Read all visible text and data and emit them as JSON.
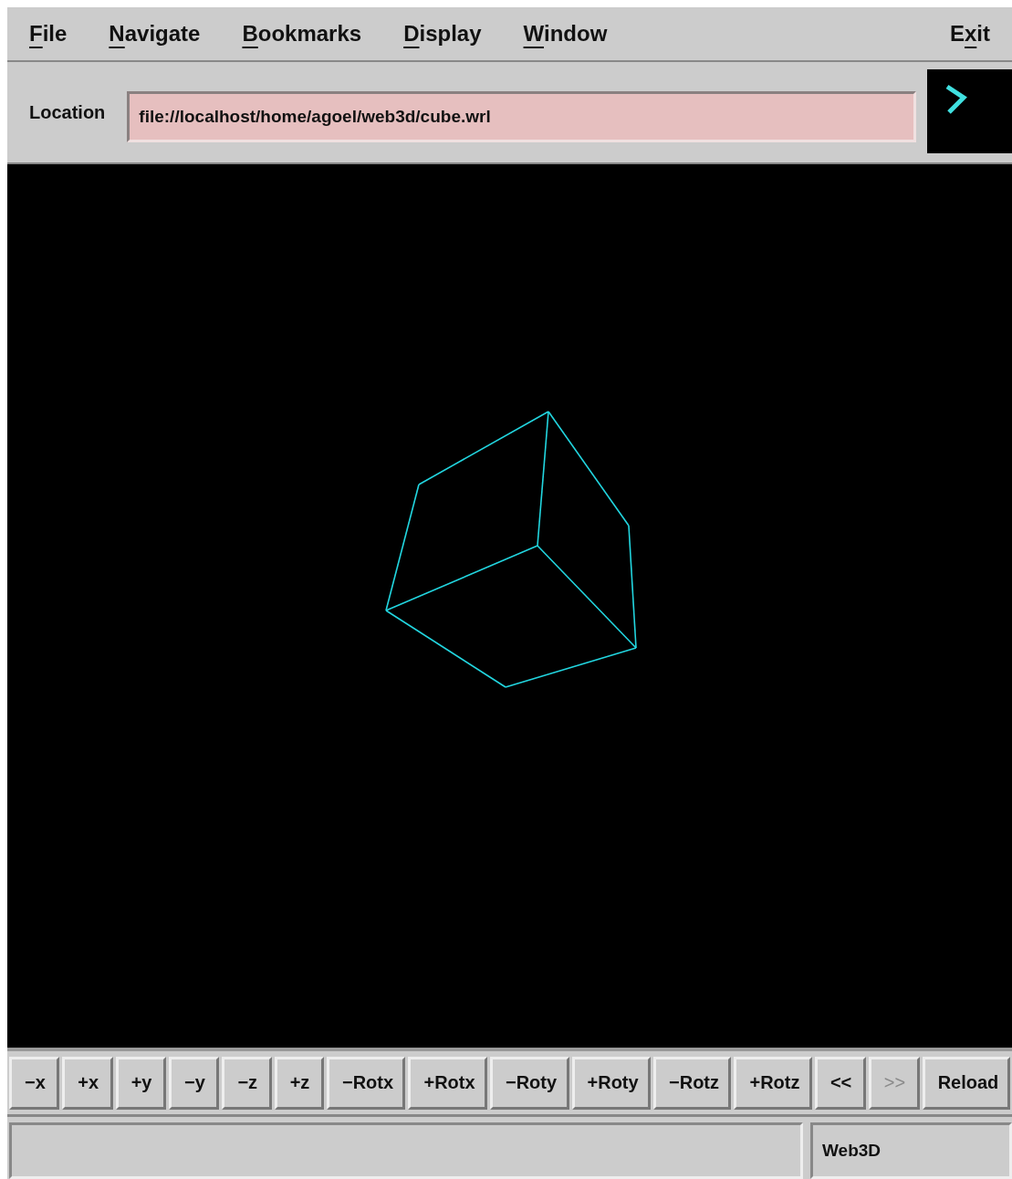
{
  "menu": [
    {
      "key": "F",
      "after": "ile"
    },
    {
      "key": "N",
      "after": "avigate"
    },
    {
      "key": "B",
      "after": "ookmarks"
    },
    {
      "key": "D",
      "after": "isplay"
    },
    {
      "key": "W",
      "after": "indow"
    }
  ],
  "exit_menu": {
    "before": "E",
    "key": "x",
    "after": "it"
  },
  "location": {
    "label": "Location",
    "value": "file://localhost/home/agoel/web3d/cube.wrl"
  },
  "toolbar": [
    {
      "label": "−x",
      "disabled": false
    },
    {
      "label": "+x",
      "disabled": false
    },
    {
      "label": "+y",
      "disabled": false
    },
    {
      "label": "−y",
      "disabled": false
    },
    {
      "label": "−z",
      "disabled": false
    },
    {
      "label": "+z",
      "disabled": false
    },
    {
      "label": "−Rotx",
      "disabled": false
    },
    {
      "label": "+Rotx",
      "disabled": false
    },
    {
      "label": "−Roty",
      "disabled": false
    },
    {
      "label": "+Roty",
      "disabled": false
    },
    {
      "label": "−Rotz",
      "disabled": false
    },
    {
      "label": "+Rotz",
      "disabled": false
    },
    {
      "label": "<<",
      "disabled": false
    },
    {
      "label": ">>",
      "disabled": true
    },
    {
      "label": "Reload",
      "disabled": false
    }
  ],
  "status_bar": {
    "message": "Web3D"
  }
}
